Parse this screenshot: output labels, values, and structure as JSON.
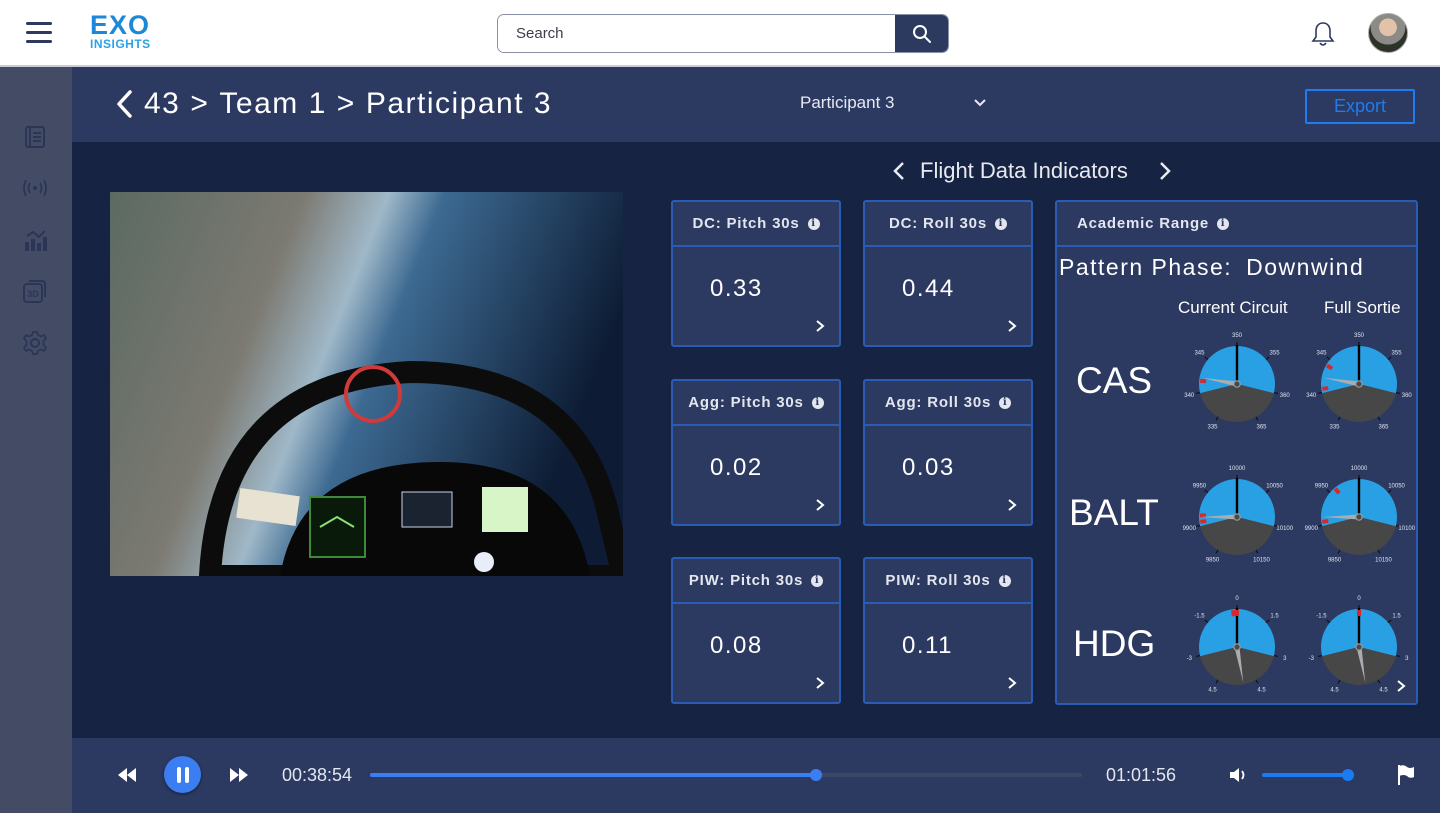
{
  "app": {
    "logo_top": "EXO",
    "logo_bottom": "INSIGHTS"
  },
  "topbar": {
    "search_placeholder": "Search",
    "search_icon": "search-icon",
    "notifications_icon": "bell-icon",
    "avatar": "user-avatar"
  },
  "sidebar": {
    "items": [
      {
        "name": "notebook",
        "icon": "notebook-icon"
      },
      {
        "name": "broadcast",
        "icon": "broadcast-icon"
      },
      {
        "name": "analytics",
        "icon": "analytics-chart-icon"
      },
      {
        "name": "3d-view",
        "icon": "3d-icon"
      },
      {
        "name": "settings",
        "icon": "gear-icon"
      }
    ]
  },
  "header": {
    "breadcrumb": [
      "43",
      "Team 1",
      "Participant 3"
    ],
    "separator": ">",
    "participant_select": "Participant 3",
    "export_label": "Export"
  },
  "indicators": {
    "title": "Flight Data Indicators",
    "cards": [
      {
        "label": "DC: Pitch 30s",
        "value": "0.33"
      },
      {
        "label": "DC: Roll 30s",
        "value": "0.44"
      },
      {
        "label": "Agg: Pitch 30s",
        "value": "0.02"
      },
      {
        "label": "Agg: Roll 30s",
        "value": "0.03"
      },
      {
        "label": "PIW: Pitch 30s",
        "value": "0.08"
      },
      {
        "label": "PIW: Roll 30s",
        "value": "0.11"
      }
    ]
  },
  "academic_range": {
    "title": "Academic Range",
    "phase_label": "Pattern Phase:",
    "phase_value": "Downwind",
    "columns": [
      "Current Circuit",
      "Full Sortie"
    ],
    "rows": [
      {
        "label": "CAS",
        "ticks": [
          "350",
          "355",
          "360",
          "365",
          "335",
          "340",
          "345"
        ],
        "current": {
          "needle_ticks": -1.6,
          "markers": [
            -1.7
          ]
        },
        "full": {
          "needle_ticks": -1.6,
          "markers": [
            -1.95,
            -1.2
          ]
        }
      },
      {
        "label": "BALT",
        "ticks": [
          "10000",
          "10050",
          "10100",
          "10150",
          "9850",
          "9900",
          "9950"
        ],
        "current": {
          "needle_ticks": -1.8,
          "markers": [
            -1.75,
            -1.95
          ]
        },
        "full": {
          "needle_ticks": -1.8,
          "markers": [
            -1.95,
            -0.8
          ]
        }
      },
      {
        "label": "HDG",
        "ticks": [
          "0",
          "1.5",
          "3",
          "4.5",
          "4.5",
          "-3",
          "-1.5"
        ],
        "current": {
          "needle_ticks": 3.4,
          "markers": [
            0.0,
            -0.12
          ]
        },
        "full": {
          "needle_ticks": 3.4,
          "markers": [
            0.0
          ]
        }
      }
    ]
  },
  "player": {
    "current_time": "00:38:54",
    "total_time": "01:01:56",
    "progress": 0.627,
    "volume": 1.0,
    "colors": {
      "accent": "#3b7ef2",
      "gauge_blue": "#2aa0e4",
      "gauge_dark": "#474747",
      "marker_red": "#d8282a"
    }
  }
}
